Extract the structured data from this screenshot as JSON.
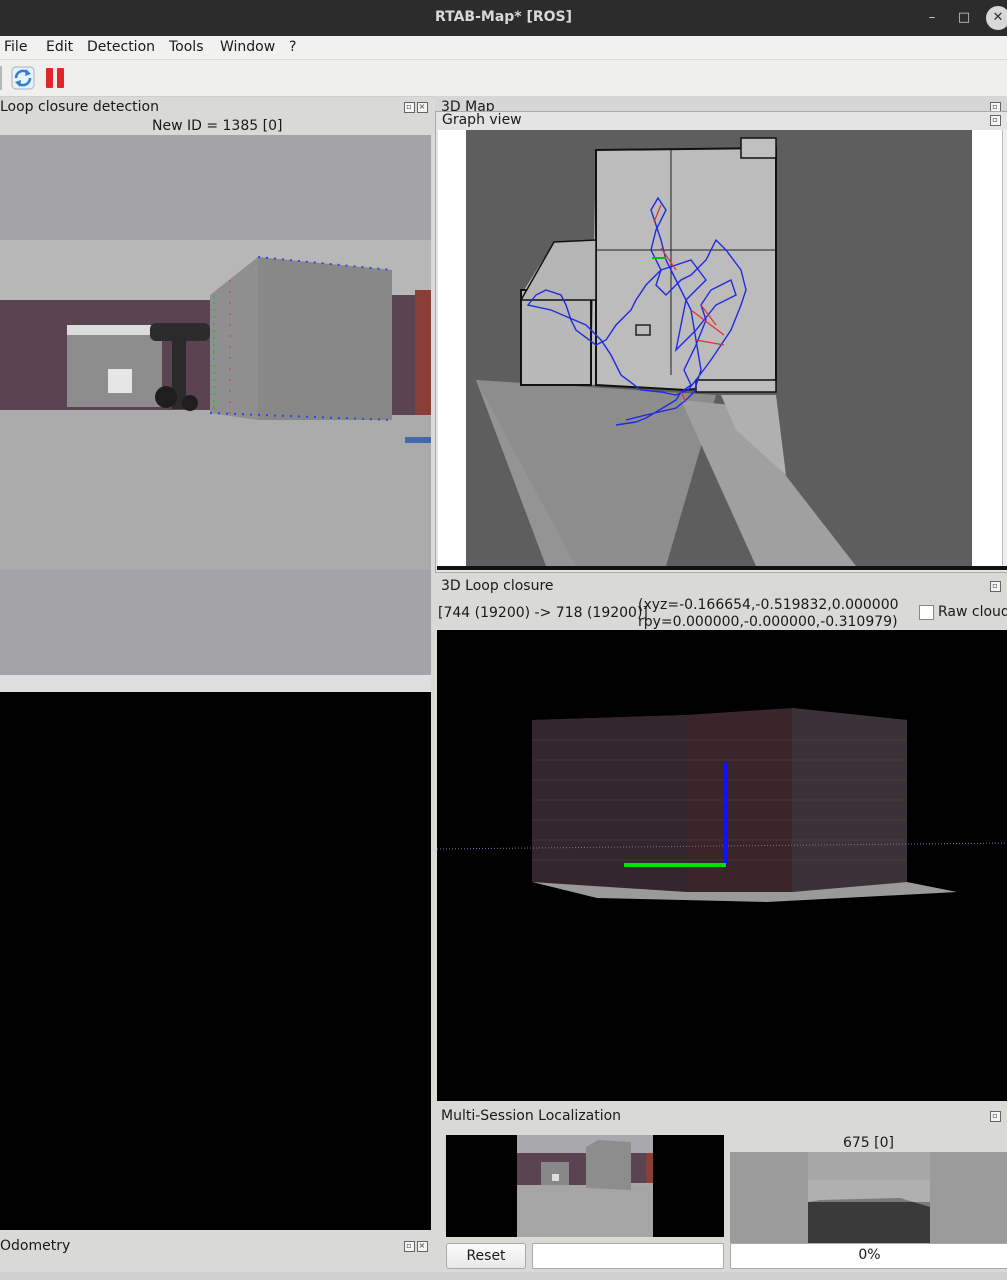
{
  "window": {
    "title": "RTAB-Map* [ROS]",
    "min": "–",
    "max": "□",
    "close": "✕"
  },
  "menu": [
    "File",
    "Edit",
    "Detection",
    "Tools",
    "Window",
    "?"
  ],
  "toolbar": {
    "refresh_icon": "refresh-icon",
    "pause_icon": "pause-icon"
  },
  "loop_closure_detection": {
    "title": "Loop closure detection",
    "new_id": "New ID = 1385 [0]"
  },
  "map3d": {
    "title": "3D Map"
  },
  "graph_view": {
    "title": "Graph view"
  },
  "loop3d": {
    "title": "3D Loop closure",
    "link": "[744 (19200) -> 718 (19200)]",
    "xyz": "(xyz=-0.166654,-0.519832,0.000000",
    "rpy": "rpy=0.000000,-0.000000,-0.310979)",
    "raw_cloud_label": "Raw  cloud",
    "raw_cloud_checked": false
  },
  "multi_session": {
    "title": "Multi-Session Localization",
    "node_label": "675 [0]",
    "reset_label": "Reset",
    "text_value": "",
    "progress_text": "0%",
    "progress": 0
  },
  "odometry": {
    "title": "Odometry"
  },
  "colors": {
    "titlebar": "#2c2c2c",
    "pause": "#e0262b",
    "graph_path": "#1f2be0",
    "axis_green": "#00e000",
    "axis_blue": "#1010ff",
    "wall": "#5a4350"
  }
}
